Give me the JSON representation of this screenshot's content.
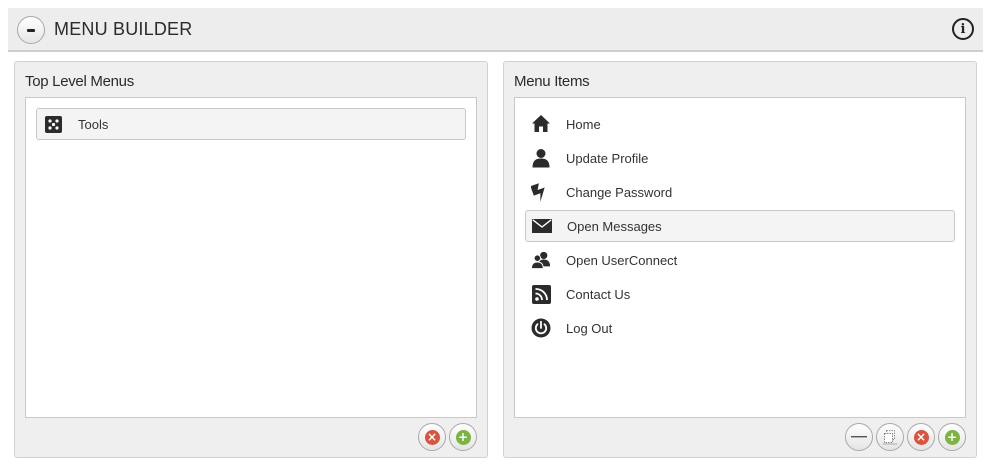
{
  "header": {
    "title": "MENU BUILDER"
  },
  "top_level_panel": {
    "title": "Top Level Menus",
    "items": [
      {
        "label": "Tools",
        "icon": "tools-icon",
        "selected": true
      }
    ]
  },
  "menu_items_panel": {
    "title": "Menu Items",
    "items": [
      {
        "label": "Home",
        "icon": "home-icon",
        "selected": false
      },
      {
        "label": "Update Profile",
        "icon": "user-icon",
        "selected": false
      },
      {
        "label": "Change Password",
        "icon": "lightning-icon",
        "selected": false
      },
      {
        "label": "Open Messages",
        "icon": "envelope-icon",
        "selected": true
      },
      {
        "label": "Open UserConnect",
        "icon": "users-icon",
        "selected": false
      },
      {
        "label": "Contact Us",
        "icon": "rss-icon",
        "selected": false
      },
      {
        "label": "Log Out",
        "icon": "power-icon",
        "selected": false
      }
    ]
  },
  "colors": {
    "remove": "#d9533f",
    "add": "#7cb342",
    "panel_bg": "#efefef",
    "header_bg": "#ededed"
  }
}
